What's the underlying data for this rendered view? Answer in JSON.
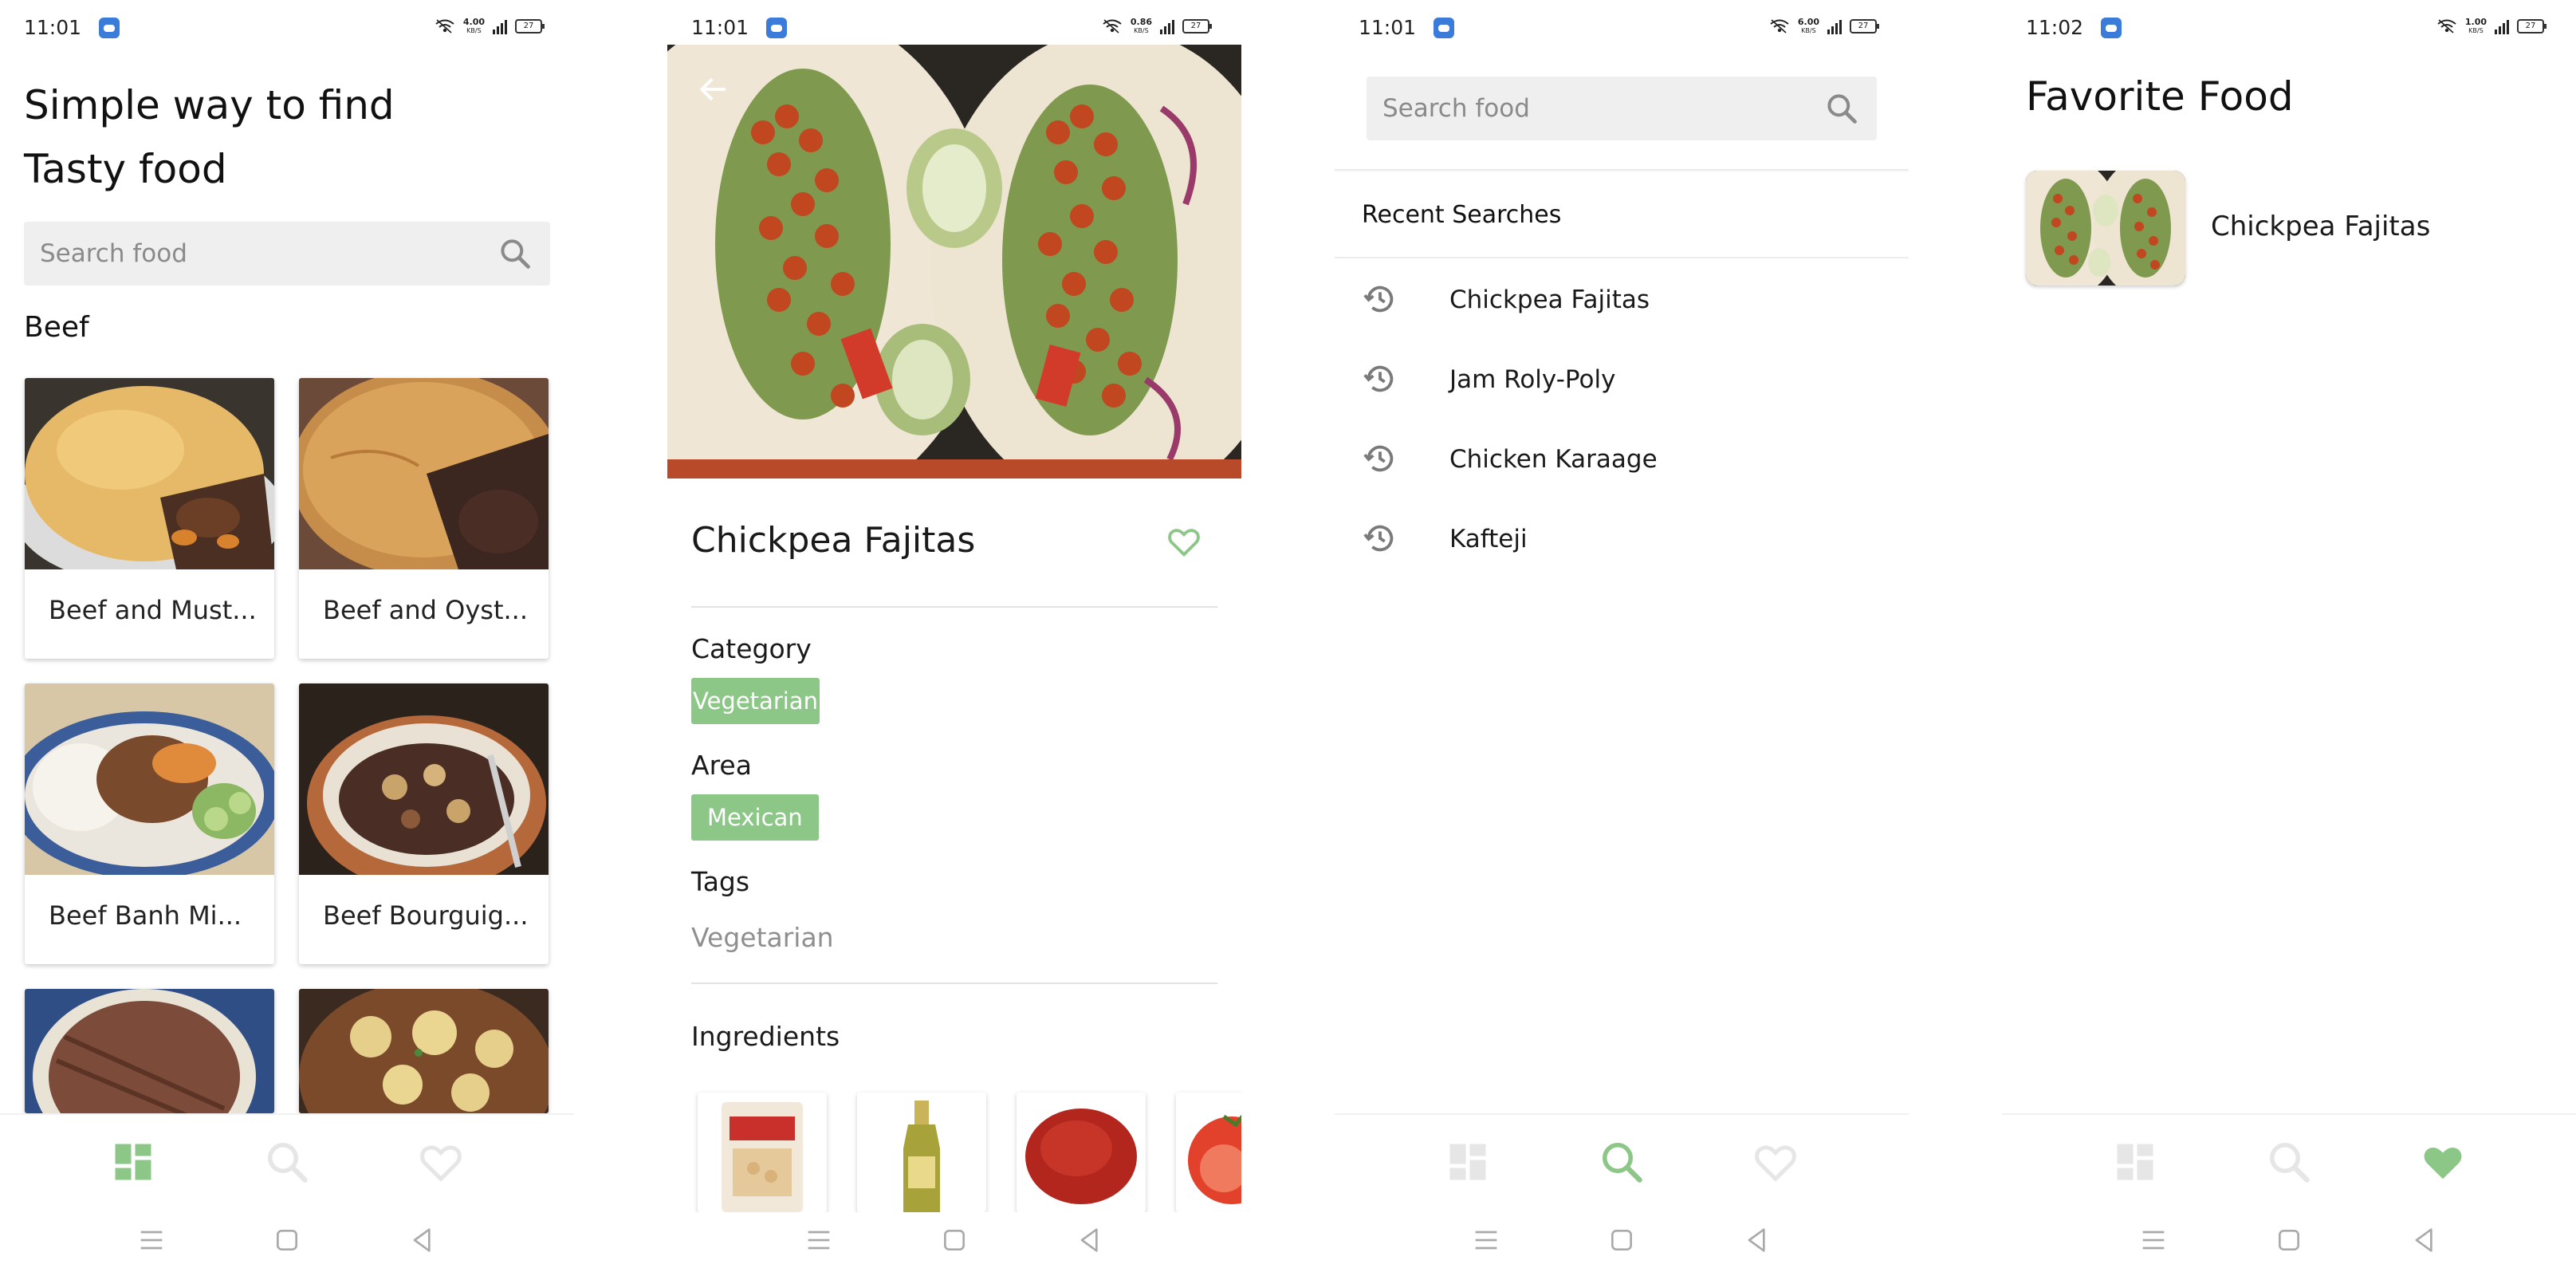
{
  "colors": {
    "accent": "#8cc788",
    "nav_inactive": "#e6e6e6",
    "chip_text": "#ffffff"
  },
  "screens": [
    {
      "status": {
        "time": "11:01",
        "speed": "4.00",
        "speed_unit": "KB/S",
        "battery": "27"
      },
      "headline_line1": "Simple way to find",
      "headline_line2": "Tasty food",
      "search_placeholder": "Search food",
      "section_title": "Beef",
      "cards": [
        {
          "label": "Beef and Must..."
        },
        {
          "label": "Beef and Oyst..."
        },
        {
          "label": "Beef Banh Mi..."
        },
        {
          "label": "Beef Bourguig..."
        }
      ],
      "nav_active": "home"
    },
    {
      "status": {
        "time": "11:01",
        "speed": "0.86",
        "speed_unit": "KB/S",
        "battery": "27"
      },
      "title": "Chickpea Fajitas",
      "category_label": "Category",
      "category_value": "Vegetarian",
      "area_label": "Area",
      "area_value": "Mexican",
      "tags_label": "Tags",
      "tags_value": "Vegetarian",
      "ingredients_label": "Ingredients"
    },
    {
      "status": {
        "time": "11:01",
        "speed": "6.00",
        "speed_unit": "KB/S",
        "battery": "27"
      },
      "search_placeholder": "Search food",
      "recent_title": "Recent Searches",
      "recent_items": [
        "Chickpea Fajitas",
        "Jam Roly-Poly",
        "Chicken Karaage",
        "Kafteji"
      ],
      "nav_active": "search"
    },
    {
      "status": {
        "time": "11:02",
        "speed": "1.00",
        "speed_unit": "KB/S",
        "battery": "27"
      },
      "title": "Favorite Food",
      "favorites": [
        {
          "name": "Chickpea Fajitas"
        }
      ],
      "nav_active": "favorite"
    }
  ]
}
